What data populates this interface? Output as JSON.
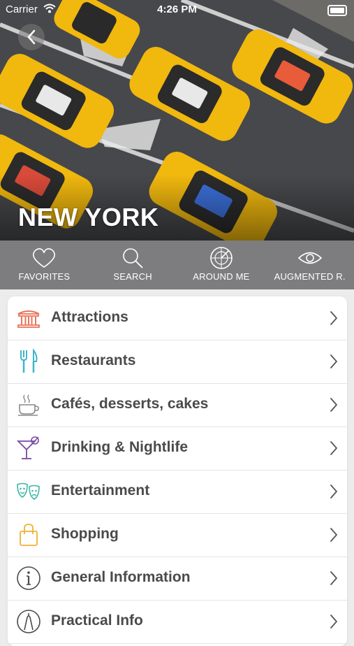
{
  "status_bar": {
    "carrier": "Carrier",
    "time": "4:26 PM"
  },
  "hero": {
    "title": "NEW YORK"
  },
  "actions": [
    {
      "label": "FAVORITES",
      "icon": "heart-icon"
    },
    {
      "label": "SEARCH",
      "icon": "search-icon"
    },
    {
      "label": "AROUND ME",
      "icon": "radar-icon"
    },
    {
      "label": "AUGMENTED R.",
      "icon": "eye-icon"
    }
  ],
  "categories": [
    {
      "label": "Attractions",
      "icon": "monument-icon",
      "color": "#e8745d"
    },
    {
      "label": "Restaurants",
      "icon": "fork-knife-icon",
      "color": "#3fb6c9"
    },
    {
      "label": "Cafés, desserts, cakes",
      "icon": "coffee-cup-icon",
      "color": "#8a8a8a"
    },
    {
      "label": "Drinking & Nightlife",
      "icon": "cocktail-icon",
      "color": "#7a4aa6"
    },
    {
      "label": "Entertainment",
      "icon": "theater-masks-icon",
      "color": "#3fb6a8"
    },
    {
      "label": "Shopping",
      "icon": "shopping-bag-icon",
      "color": "#f2b134"
    },
    {
      "label": "General Information",
      "icon": "info-icon",
      "color": "#4a4a4c"
    },
    {
      "label": "Practical Info",
      "icon": "practical-info-icon",
      "color": "#4a4a4c"
    }
  ]
}
